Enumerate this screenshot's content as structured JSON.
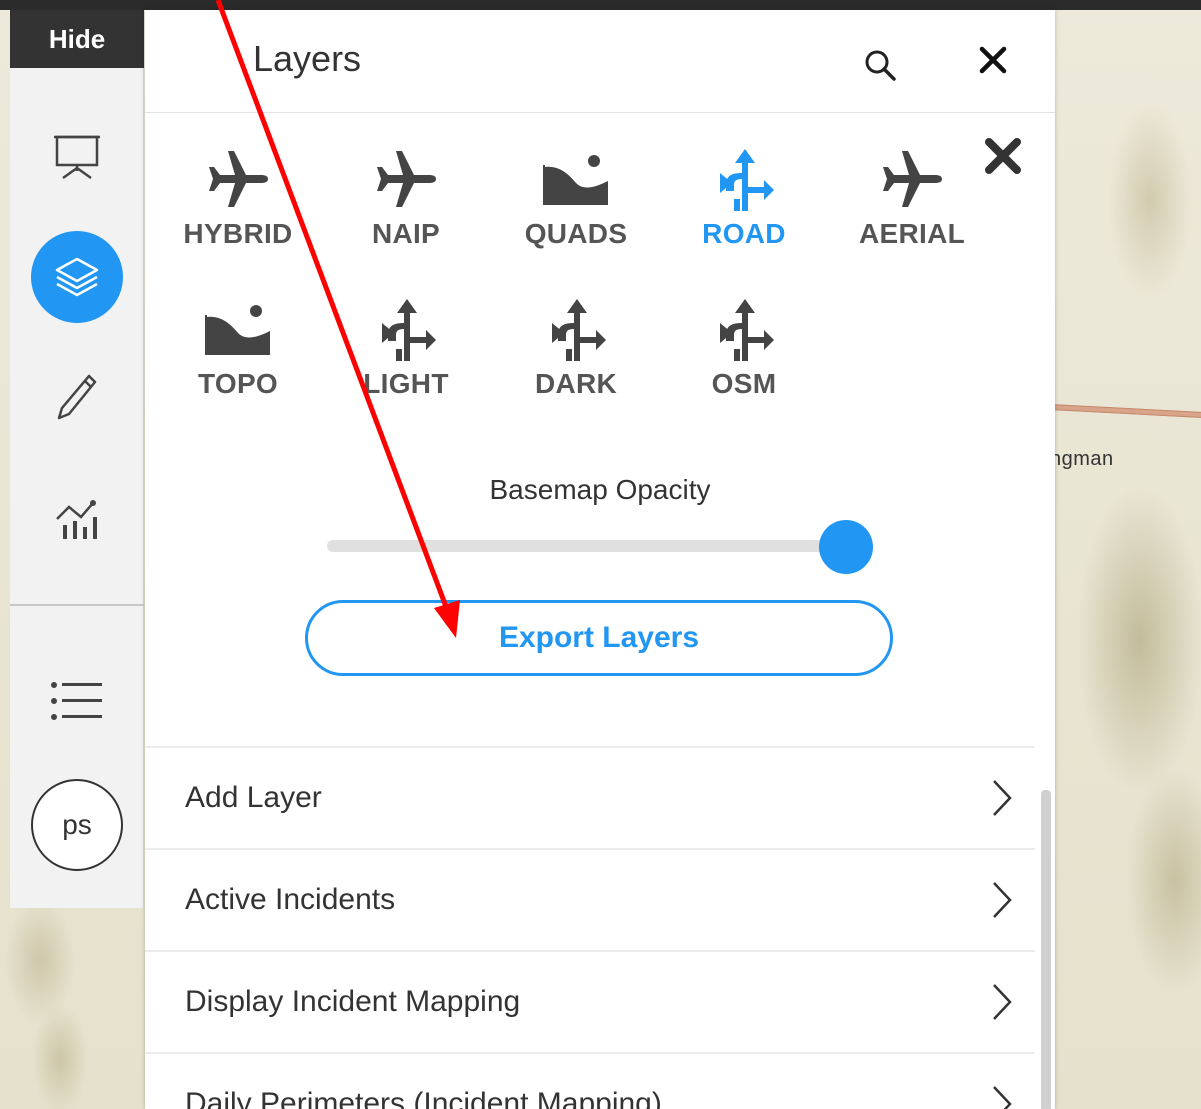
{
  "map": {
    "town_label": "ngman"
  },
  "rail": {
    "hide_label": "Hide",
    "avatar_initials": "ps",
    "items": [
      {
        "name": "presentation-icon"
      },
      {
        "name": "layers-icon",
        "active": true
      },
      {
        "name": "pencil-icon"
      },
      {
        "name": "chart-icon"
      },
      {
        "name": "list-icon"
      }
    ]
  },
  "panel": {
    "title": "Layers",
    "basemaps": [
      {
        "label": "HYBRID",
        "icon": "plane-icon",
        "active": false
      },
      {
        "label": "NAIP",
        "icon": "plane-icon",
        "active": false
      },
      {
        "label": "QUADS",
        "icon": "terrain-icon",
        "active": false
      },
      {
        "label": "ROAD",
        "icon": "road-sign-icon",
        "active": true
      },
      {
        "label": "AERIAL",
        "icon": "plane-icon",
        "active": false
      },
      {
        "label": "TOPO",
        "icon": "terrain-icon",
        "active": false
      },
      {
        "label": "LIGHT",
        "icon": "road-sign-icon",
        "active": false
      },
      {
        "label": "DARK",
        "icon": "road-sign-icon",
        "active": false
      },
      {
        "label": "OSM",
        "icon": "road-sign-icon",
        "active": false
      }
    ],
    "opacity_label": "Basemap Opacity",
    "opacity_value": 1.0,
    "export_label": "Export Layers",
    "list_items": [
      "Add Layer",
      "Active Incidents",
      "Display Incident Mapping",
      "Daily Perimeters (Incident Mapping)"
    ]
  },
  "colors": {
    "accent": "#2196f3",
    "annotation_arrow": "#ff0000",
    "rail_dark": "#333333"
  }
}
